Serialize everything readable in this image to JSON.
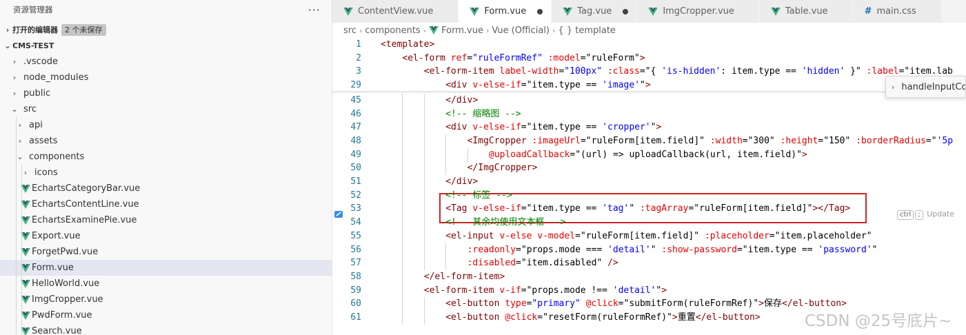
{
  "sidebar": {
    "title": "资源管理器",
    "more": "···",
    "open_editors": {
      "label": "打开的编辑器",
      "badge": "2 个未保存"
    },
    "project": {
      "label": "CMS-TEST"
    },
    "items": [
      {
        "label": ".vscode",
        "type": "folder",
        "expanded": false,
        "depth": 1
      },
      {
        "label": "node_modules",
        "type": "folder",
        "expanded": false,
        "depth": 1
      },
      {
        "label": "public",
        "type": "folder",
        "expanded": false,
        "depth": 1
      },
      {
        "label": "src",
        "type": "folder",
        "expanded": true,
        "depth": 1
      },
      {
        "label": "api",
        "type": "folder",
        "expanded": false,
        "depth": 2
      },
      {
        "label": "assets",
        "type": "folder",
        "expanded": false,
        "depth": 2
      },
      {
        "label": "components",
        "type": "folder",
        "expanded": true,
        "depth": 2
      },
      {
        "label": "icons",
        "type": "folder",
        "expanded": false,
        "depth": 3
      },
      {
        "label": "EchartsCategoryBar.vue",
        "type": "vue",
        "depth": 3
      },
      {
        "label": "EchartsContentLine.vue",
        "type": "vue",
        "depth": 3
      },
      {
        "label": "EchartsExaminePie.vue",
        "type": "vue",
        "depth": 3
      },
      {
        "label": "Export.vue",
        "type": "vue",
        "depth": 3
      },
      {
        "label": "ForgetPwd.vue",
        "type": "vue",
        "depth": 3
      },
      {
        "label": "Form.vue",
        "type": "vue",
        "depth": 3,
        "selected": true
      },
      {
        "label": "HelloWorld.vue",
        "type": "vue",
        "depth": 3
      },
      {
        "label": "ImgCropper.vue",
        "type": "vue",
        "depth": 3
      },
      {
        "label": "PwdForm.vue",
        "type": "vue",
        "depth": 3
      },
      {
        "label": "Search.vue",
        "type": "vue",
        "depth": 3
      }
    ]
  },
  "tabs": [
    {
      "label": "ContentView.vue",
      "icon": "vue",
      "active": false,
      "dirty": false
    },
    {
      "label": "Form.vue",
      "icon": "vue",
      "active": true,
      "dirty": true
    },
    {
      "label": "Tag.vue",
      "icon": "vue",
      "active": false,
      "dirty": true
    },
    {
      "label": "ImgCropper.vue",
      "icon": "vue",
      "active": false,
      "dirty": false
    },
    {
      "label": "Table.vue",
      "icon": "vue",
      "active": false,
      "dirty": false
    },
    {
      "label": "main.css",
      "icon": "css",
      "active": false,
      "dirty": false
    }
  ],
  "breadcrumb": [
    "src",
    "components",
    "Form.vue",
    "Vue (Official)",
    "{ } template"
  ],
  "suggest": {
    "label": "handleInputCo"
  },
  "hint": {
    "key1": "ctrl",
    "key2": ";",
    "text": "Update"
  },
  "watermark": "CSDN @25号底片~",
  "code_lines": [
    {
      "n": "1",
      "indent": 0,
      "tokens": [
        [
          "t",
          "<template>"
        ]
      ]
    },
    {
      "n": "2",
      "indent": 1,
      "tokens": [
        [
          "t",
          "<el-form "
        ],
        [
          "a",
          "ref"
        ],
        [
          "x",
          "="
        ],
        [
          "s",
          "\"ruleFormRef\""
        ],
        [
          "x",
          " "
        ],
        [
          "a",
          ":model"
        ],
        [
          "x",
          "=\"ruleForm\""
        ],
        [
          "t",
          ">"
        ]
      ]
    },
    {
      "n": "3",
      "indent": 2,
      "tokens": [
        [
          "t",
          "<el-form-item "
        ],
        [
          "a",
          "label-width"
        ],
        [
          "x",
          "="
        ],
        [
          "s",
          "\"100px\""
        ],
        [
          "x",
          " "
        ],
        [
          "a",
          ":class"
        ],
        [
          "x",
          "=\"{ "
        ],
        [
          "s",
          "'is-hidden'"
        ],
        [
          "x",
          ": item.type == "
        ],
        [
          "s",
          "'hidden'"
        ],
        [
          "x",
          " }\" "
        ],
        [
          "a",
          ":label"
        ],
        [
          "x",
          "=\"item.lab"
        ]
      ]
    },
    {
      "n": "29",
      "indent": 3,
      "tokens": [
        [
          "t",
          "<div "
        ],
        [
          "a",
          "v-else-if"
        ],
        [
          "x",
          "=\"item.type == "
        ],
        [
          "s",
          "'image'"
        ],
        [
          "x",
          "\""
        ],
        [
          "t",
          ">"
        ]
      ]
    },
    {
      "n": "45",
      "indent": 3,
      "tokens": [
        [
          "t",
          "</div>"
        ]
      ]
    },
    {
      "n": "46",
      "indent": 3,
      "tokens": [
        [
          "c",
          "<!-- 缩略图 -->"
        ]
      ]
    },
    {
      "n": "47",
      "indent": 3,
      "tokens": [
        [
          "t",
          "<div "
        ],
        [
          "a",
          "v-else-if"
        ],
        [
          "x",
          "=\"item.type == "
        ],
        [
          "s",
          "'cropper'"
        ],
        [
          "x",
          "\""
        ],
        [
          "t",
          ">"
        ]
      ]
    },
    {
      "n": "48",
      "indent": 4,
      "tokens": [
        [
          "t",
          "<ImgCropper "
        ],
        [
          "a",
          ":imageUrl"
        ],
        [
          "x",
          "=\"ruleForm[item.field]\" "
        ],
        [
          "a",
          ":width"
        ],
        [
          "x",
          "=\"300\" "
        ],
        [
          "a",
          ":height"
        ],
        [
          "x",
          "=\"150\" "
        ],
        [
          "a",
          ":borderRadius"
        ],
        [
          "x",
          "=\""
        ],
        [
          "s",
          "'5p"
        ]
      ]
    },
    {
      "n": "49",
      "indent": 5,
      "tokens": [
        [
          "a",
          "@uploadCallback"
        ],
        [
          "x",
          "=\"(url) => uploadCallback(url, item.field)\""
        ],
        [
          "t",
          ">"
        ]
      ]
    },
    {
      "n": "50",
      "indent": 4,
      "tokens": [
        [
          "t",
          "</ImgCropper>"
        ]
      ]
    },
    {
      "n": "51",
      "indent": 3,
      "tokens": [
        [
          "t",
          "</div>"
        ]
      ]
    },
    {
      "n": "52",
      "indent": 3,
      "tokens": [
        [
          "c",
          "<!-- 标签 -->"
        ]
      ]
    },
    {
      "n": "53",
      "indent": 3,
      "tokens": [
        [
          "t",
          "<Tag "
        ],
        [
          "a",
          "v-else-if"
        ],
        [
          "x",
          "=\"item.type == "
        ],
        [
          "s",
          "'tag'"
        ],
        [
          "x",
          "\" "
        ],
        [
          "a",
          ":tagArray"
        ],
        [
          "x",
          "=\"ruleForm[item.field]\""
        ],
        [
          "t",
          "></Tag>"
        ]
      ]
    },
    {
      "n": "54",
      "indent": 3,
      "tokens": [
        [
          "c",
          "<!-- 其余均使用文本框 -->"
        ]
      ]
    },
    {
      "n": "55",
      "indent": 3,
      "tokens": [
        [
          "t",
          "<el-input "
        ],
        [
          "a",
          "v-else"
        ],
        [
          "x",
          " "
        ],
        [
          "a",
          "v-model"
        ],
        [
          "x",
          "=\"ruleForm[item.field]\" "
        ],
        [
          "a",
          ":placeholder"
        ],
        [
          "x",
          "=\"item.placeholder\""
        ]
      ]
    },
    {
      "n": "56",
      "indent": 4,
      "tokens": [
        [
          "a",
          ":readonly"
        ],
        [
          "x",
          "=\"props.mode === "
        ],
        [
          "s",
          "'detail'"
        ],
        [
          "x",
          "\" "
        ],
        [
          "a",
          ":show-password"
        ],
        [
          "x",
          "=\"item.type == "
        ],
        [
          "s",
          "'password'"
        ],
        [
          "x",
          "\""
        ]
      ]
    },
    {
      "n": "57",
      "indent": 4,
      "tokens": [
        [
          "a",
          ":disabled"
        ],
        [
          "x",
          "=\"item.disabled\" "
        ],
        [
          "t",
          "/>"
        ]
      ]
    },
    {
      "n": "58",
      "indent": 2,
      "tokens": [
        [
          "t",
          "</el-form-item>"
        ]
      ]
    },
    {
      "n": "59",
      "indent": 2,
      "tokens": [
        [
          "t",
          "<el-form-item "
        ],
        [
          "a",
          "v-if"
        ],
        [
          "x",
          "=\"props.mode !== "
        ],
        [
          "s",
          "'detail'"
        ],
        [
          "x",
          "\""
        ],
        [
          "t",
          ">"
        ]
      ]
    },
    {
      "n": "60",
      "indent": 3,
      "tokens": [
        [
          "t",
          "<el-button "
        ],
        [
          "a",
          "type"
        ],
        [
          "x",
          "="
        ],
        [
          "s",
          "\"primary\""
        ],
        [
          "x",
          " "
        ],
        [
          "a",
          "@click"
        ],
        [
          "x",
          "=\"submitForm(ruleFormRef)\""
        ],
        [
          "t",
          ">"
        ],
        [
          "x",
          "保存"
        ],
        [
          "t",
          "</el-button>"
        ]
      ]
    },
    {
      "n": "61",
      "indent": 3,
      "tokens": [
        [
          "t",
          "<el-button "
        ],
        [
          "a",
          "@click"
        ],
        [
          "x",
          "=\"resetForm(ruleFormRef)\""
        ],
        [
          "t",
          ">"
        ],
        [
          "x",
          "重置"
        ],
        [
          "t",
          "</el-button>"
        ]
      ]
    }
  ]
}
